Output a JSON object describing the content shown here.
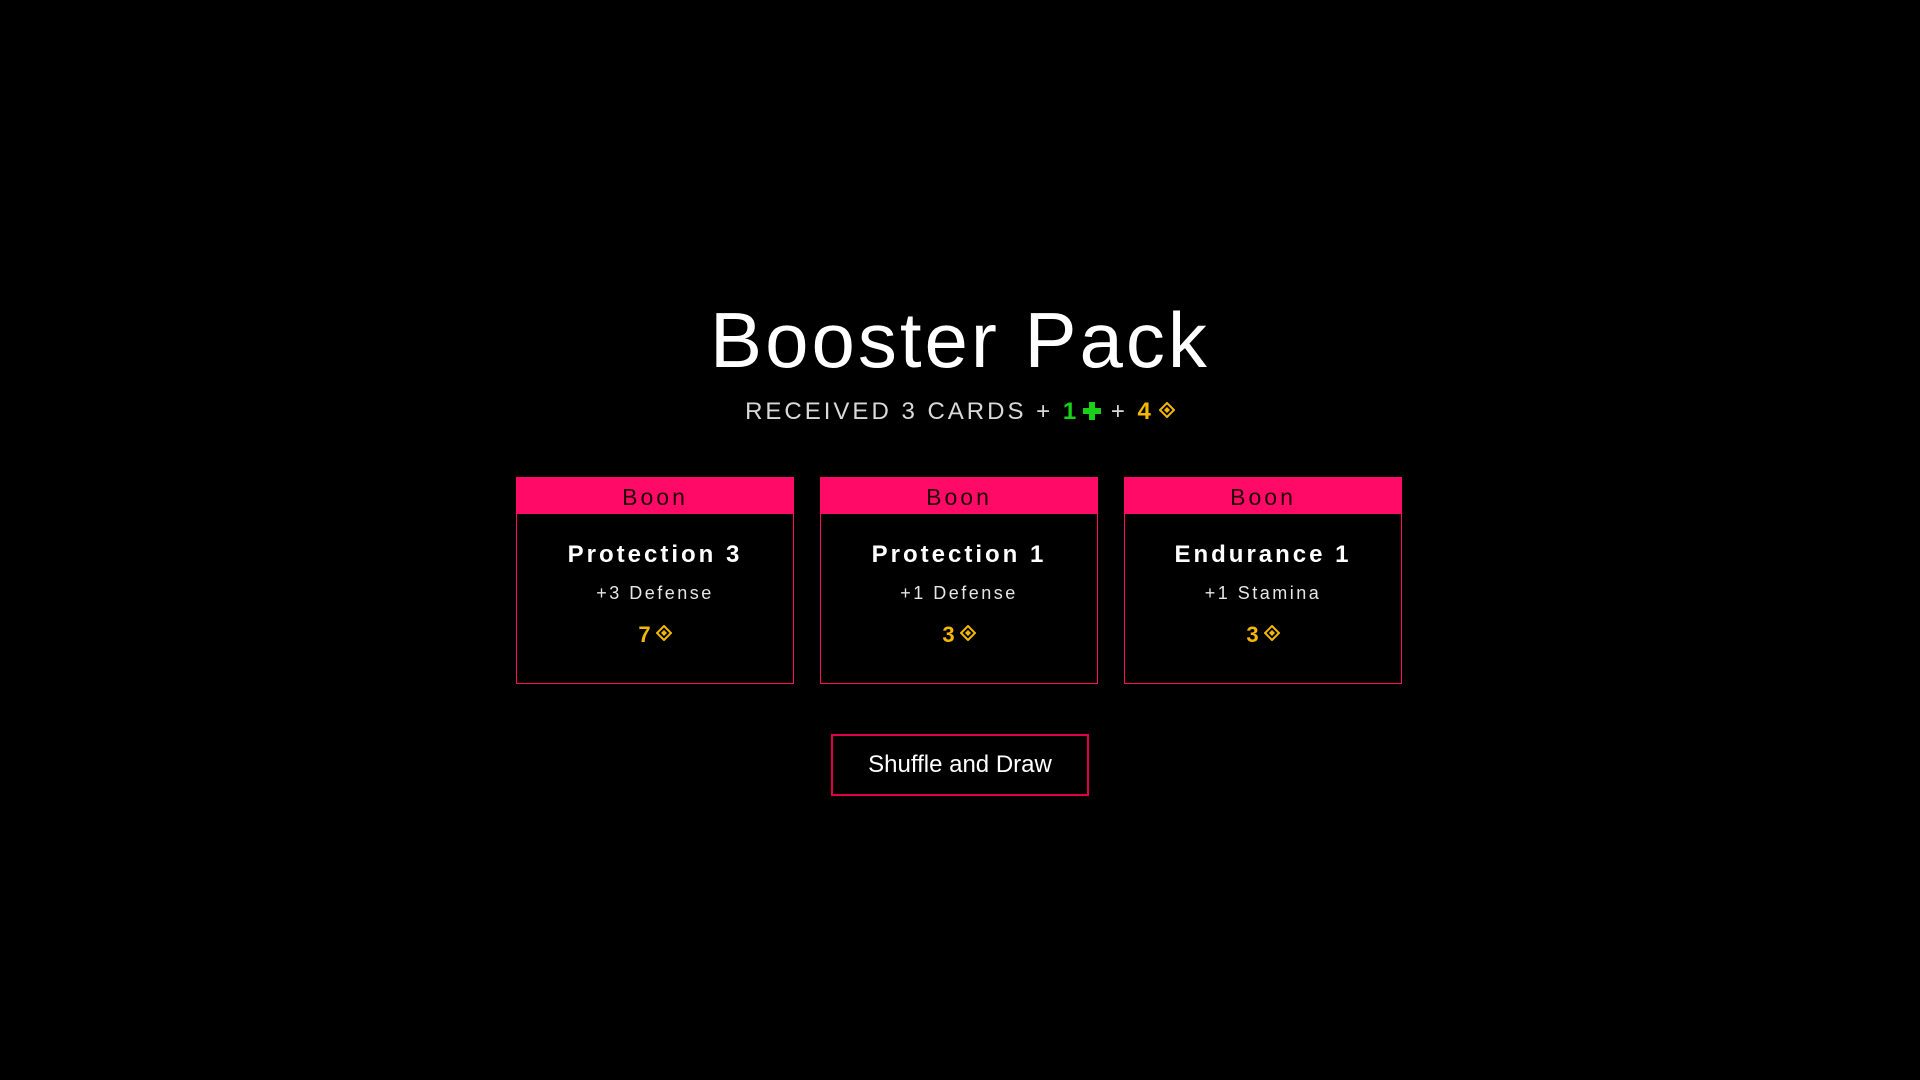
{
  "title": "Booster Pack",
  "subtitle": {
    "prefix": "RECEIVED 3 CARDS + ",
    "health_amount": "1",
    "separator": " + ",
    "gold_amount": "4",
    "health_icon": "plus-icon",
    "gold_icon": "gem-icon"
  },
  "colors": {
    "background": "#000000",
    "accent": "#ff0a66",
    "gold": "#f5b800",
    "health": "#19d119"
  },
  "cards": [
    {
      "type": "Boon",
      "name": "Protection 3",
      "effect": "+3 Defense",
      "cost": "7",
      "cost_icon": "gem-icon"
    },
    {
      "type": "Boon",
      "name": "Protection 1",
      "effect": "+1 Defense",
      "cost": "3",
      "cost_icon": "gem-icon"
    },
    {
      "type": "Boon",
      "name": "Endurance 1",
      "effect": "+1 Stamina",
      "cost": "3",
      "cost_icon": "gem-icon"
    }
  ],
  "actions": {
    "shuffle_label": "Shuffle and Draw"
  }
}
